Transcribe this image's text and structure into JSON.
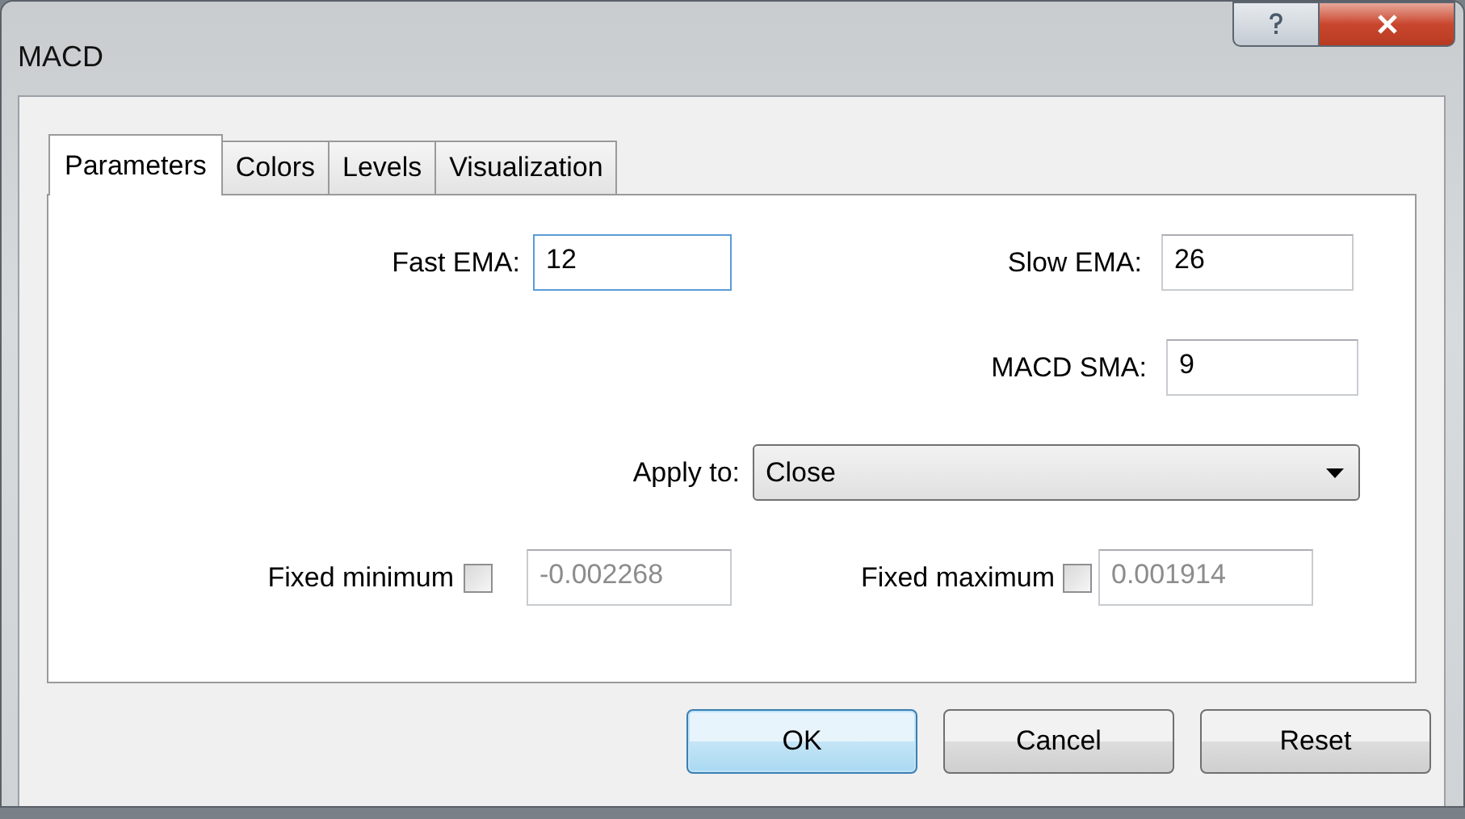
{
  "window": {
    "title": "MACD"
  },
  "tabs": [
    {
      "label": "Parameters",
      "selected": true
    },
    {
      "label": "Colors",
      "selected": false
    },
    {
      "label": "Levels",
      "selected": false
    },
    {
      "label": "Visualization",
      "selected": false
    }
  ],
  "parameters": {
    "fast_ema": {
      "label": "Fast EMA:",
      "value": "12",
      "focused": true
    },
    "slow_ema": {
      "label": "Slow EMA:",
      "value": "26",
      "focused": false
    },
    "macd_sma": {
      "label": "MACD SMA:",
      "value": "9",
      "focused": false
    },
    "apply_to": {
      "label": "Apply to:",
      "value": "Close"
    },
    "fixed_minimum": {
      "label": "Fixed minimum",
      "checked": false,
      "value": "-0.002268",
      "disabled": true
    },
    "fixed_maximum": {
      "label": "Fixed maximum",
      "checked": false,
      "value": "0.001914",
      "disabled": true
    }
  },
  "buttons": [
    {
      "label": "OK",
      "default": true
    },
    {
      "label": "Cancel",
      "default": false
    },
    {
      "label": "Reset",
      "default": false
    }
  ]
}
